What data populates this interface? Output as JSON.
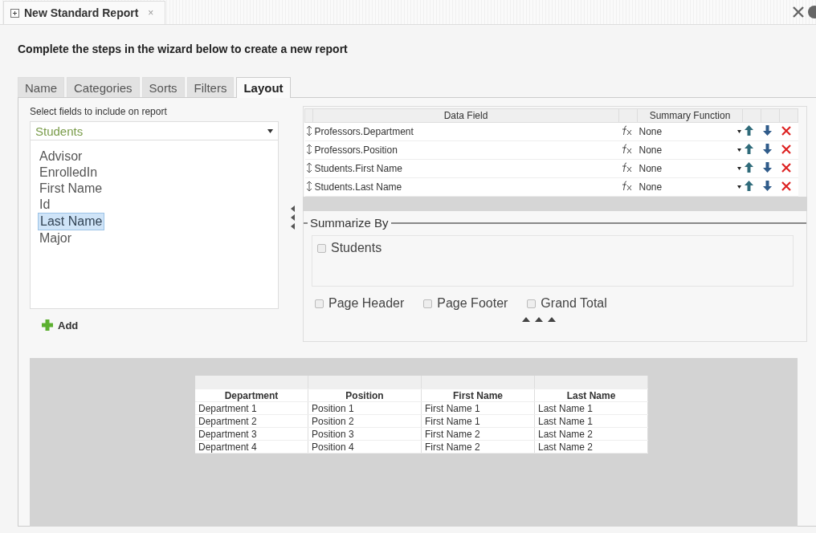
{
  "document_tab": {
    "title": "New Standard Report",
    "close": "×"
  },
  "heading": "Complete the steps in the wizard below to create a new report",
  "tabs": [
    {
      "label": "Name",
      "selected": false
    },
    {
      "label": "Categories",
      "selected": false
    },
    {
      "label": "Sorts",
      "selected": false
    },
    {
      "label": "Filters",
      "selected": false
    },
    {
      "label": "Layout",
      "selected": true
    }
  ],
  "field_picker": {
    "label": "Select fields to include on report",
    "source": "Students",
    "add_button": "Add",
    "fields": [
      {
        "label": "Advisor",
        "selected": false
      },
      {
        "label": "EnrolledIn",
        "selected": false
      },
      {
        "label": "First Name",
        "selected": false
      },
      {
        "label": "Id",
        "selected": false
      },
      {
        "label": "Last Name",
        "selected": true
      },
      {
        "label": "Major",
        "selected": false
      }
    ]
  },
  "data_fields": {
    "columns": [
      "Data Field",
      "Summary Function"
    ],
    "rows": [
      {
        "field": "Professors.Department",
        "summary": "None"
      },
      {
        "field": "Professors.Position",
        "summary": "None"
      },
      {
        "field": "Students.First Name",
        "summary": "None"
      },
      {
        "field": "Students.Last Name",
        "summary": "None"
      }
    ]
  },
  "summarize_by": {
    "title": "Summarize By",
    "groups": [
      {
        "label": "Students",
        "checked": false
      }
    ],
    "options": [
      {
        "label": "Page Header",
        "checked": false
      },
      {
        "label": "Page Footer",
        "checked": false
      },
      {
        "label": "Grand Total",
        "checked": false
      }
    ]
  },
  "preview": {
    "columns": [
      "Department",
      "Position",
      "First Name",
      "Last Name"
    ],
    "rows": [
      [
        "Department 1",
        "Position 1",
        "First Name 1",
        "Last Name 1"
      ],
      [
        "Department 2",
        "Position 2",
        "First Name 1",
        "Last Name 1"
      ],
      [
        "Department 3",
        "Position 3",
        "First Name 2",
        "Last Name 2"
      ],
      [
        "Department 4",
        "Position 4",
        "First Name 2",
        "Last Name 2"
      ]
    ]
  }
}
